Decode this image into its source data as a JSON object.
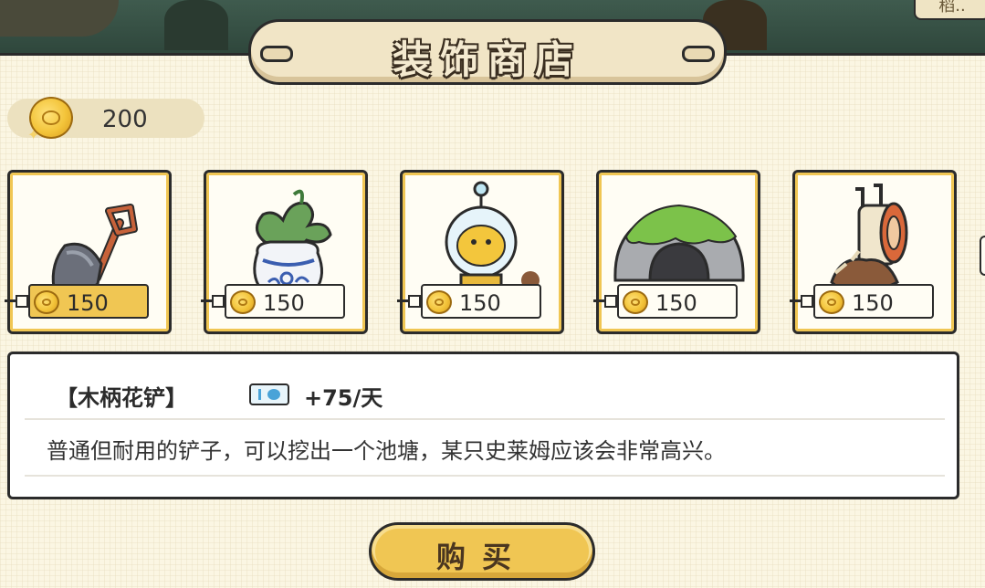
{
  "header": {
    "title": "装饰商店",
    "corner_label": "稻.."
  },
  "wallet": {
    "icon": "coin-icon",
    "balance": "200"
  },
  "shop": {
    "items": [
      {
        "name": "shovel",
        "icon": "coin-icon",
        "price": "150",
        "selected": true
      },
      {
        "name": "potted-plant",
        "icon": "coin-icon",
        "price": "150",
        "selected": false
      },
      {
        "name": "lamp",
        "icon": "coin-icon",
        "price": "150",
        "selected": false
      },
      {
        "name": "mossy-cave",
        "icon": "coin-icon",
        "price": "150",
        "selected": false
      },
      {
        "name": "wooden-stump",
        "icon": "coin-icon",
        "price": "150",
        "selected": false
      }
    ]
  },
  "detail": {
    "item_name": "【木柄花铲】",
    "reward_icon": "ticket-icon",
    "reward": "+75/天",
    "description": "普通但耐用的铲子，可以挖出一个池塘，某只史莱姆应该会非常高兴。"
  },
  "actions": {
    "buy_label": "购买"
  },
  "colors": {
    "accent": "#f0c653",
    "outline": "#2b2b2b",
    "panel": "#fffdf4",
    "background": "#fbf6e3"
  }
}
